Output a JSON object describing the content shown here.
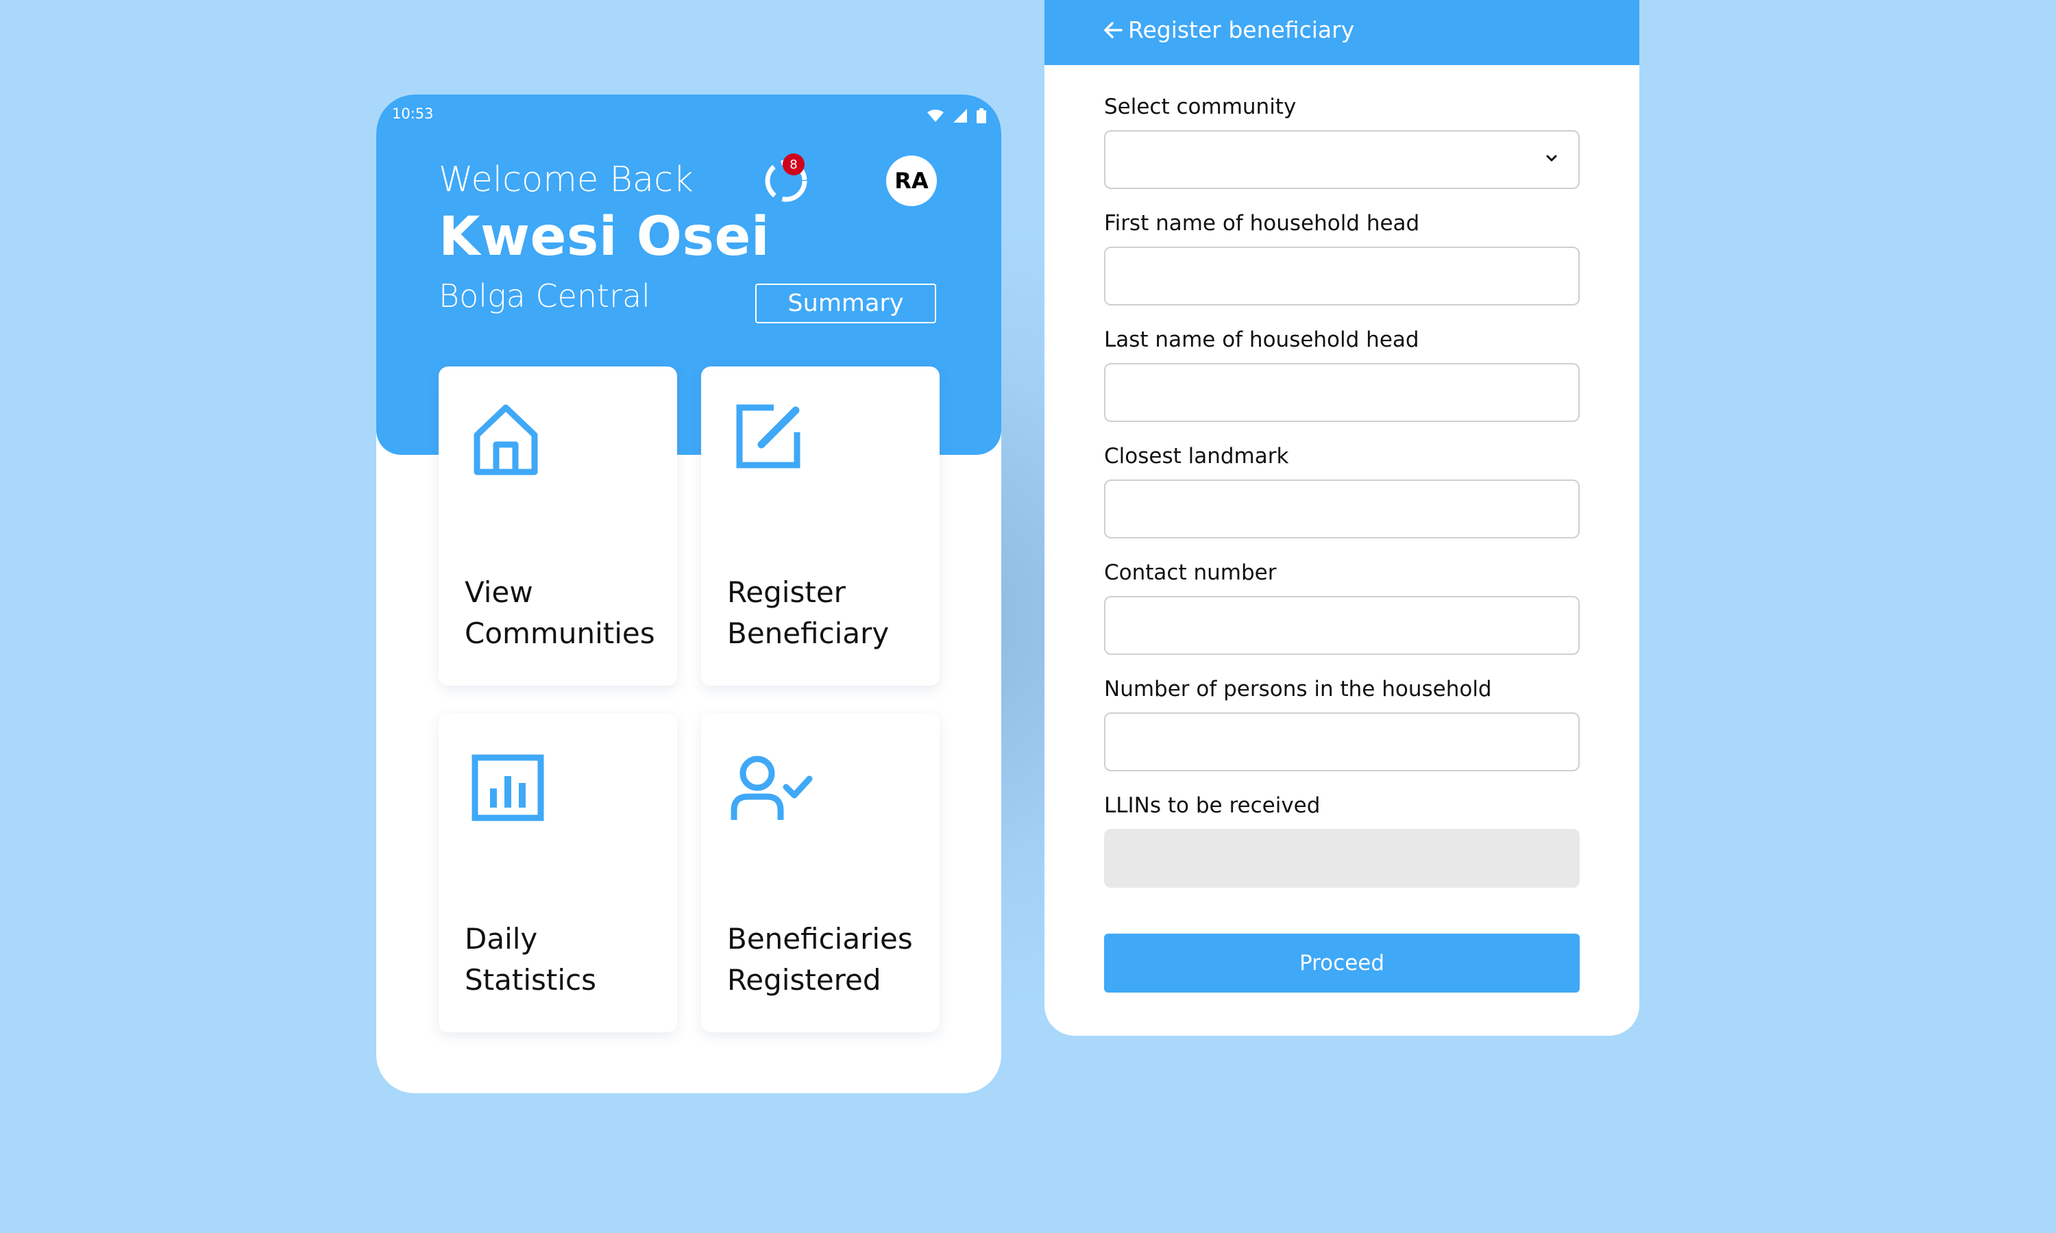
{
  "colors": {
    "background": "#a9d8fb",
    "primary": "#3fa8f7",
    "badge": "#d0021b"
  },
  "status_bar": {
    "time": "10:53",
    "icons": [
      "wifi-icon",
      "signal-icon",
      "battery-icon"
    ]
  },
  "home": {
    "welcome": "Welcome Back",
    "user_name": "Kwesi Osei",
    "location": "Bolga Central",
    "summary_button": "Summary",
    "sync_badge_count": "8",
    "avatar_initials": "RA",
    "tiles": [
      {
        "icon": "home-icon",
        "line1": "View",
        "line2": "Communities"
      },
      {
        "icon": "edit-icon",
        "line1": "Register",
        "line2": "Beneficiary"
      },
      {
        "icon": "bar-chart-icon",
        "line1": "Daily",
        "line2": "Statistics"
      },
      {
        "icon": "user-check-icon",
        "line1": "Beneficiaries",
        "line2": "Registered"
      }
    ]
  },
  "register_form": {
    "title": "Register beneficiary",
    "fields": [
      {
        "label": "Select community",
        "type": "select",
        "value": ""
      },
      {
        "label": "First name of household head",
        "type": "text",
        "value": ""
      },
      {
        "label": "Last name of household head",
        "type": "text",
        "value": ""
      },
      {
        "label": "Closest landmark",
        "type": "text",
        "value": ""
      },
      {
        "label": "Contact number",
        "type": "text",
        "value": ""
      },
      {
        "label": "Number of persons in the household",
        "type": "text",
        "value": ""
      },
      {
        "label": "LLINs to be received",
        "type": "readonly",
        "value": ""
      }
    ],
    "proceed_button": "Proceed"
  }
}
